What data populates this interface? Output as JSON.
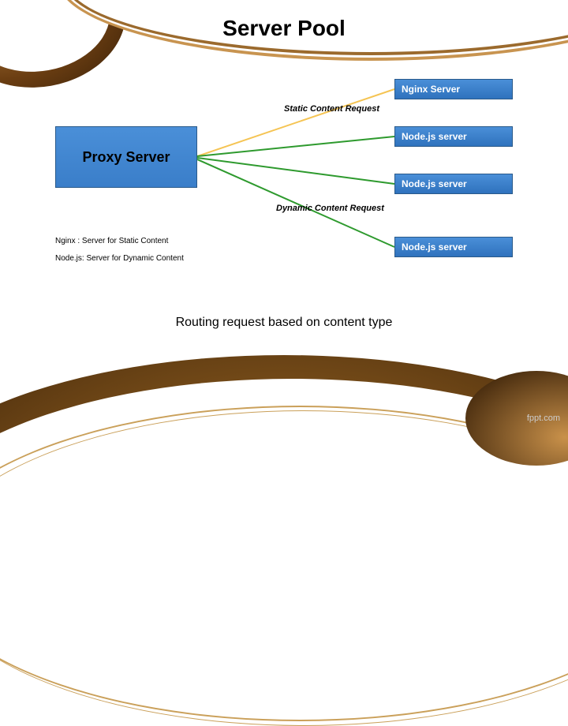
{
  "title": "Server Pool",
  "proxy_label": "Proxy Server",
  "servers": {
    "s1": "Nginx Server",
    "s2": "Node.js server",
    "s3": "Node.js server",
    "s4": "Node.js server"
  },
  "labels": {
    "static": "Static Content Request",
    "dynamic": "Dynamic Content Request"
  },
  "legend": {
    "l1": "Nginx  : Server for Static Content",
    "l2": "Node.js: Server for Dynamic Content"
  },
  "caption": "Routing request based on content type",
  "watermark": "fppt.com",
  "colors": {
    "static_line": "#f5c453",
    "dynamic_line": "#2e9a2e"
  }
}
